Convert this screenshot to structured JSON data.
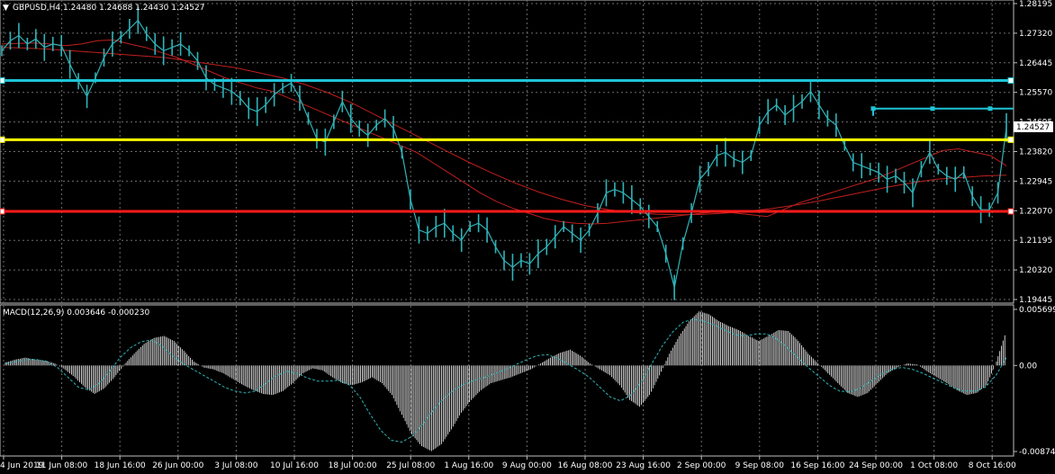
{
  "header": {
    "symbol_info": "GBPUSD,H4  1.24480 1.24688 1.24430 1.24527"
  },
  "macd": {
    "label": "MACD(12,26,9) 0.003646 -0.000230"
  },
  "price_axis": {
    "ticks": [
      "1.28195",
      "1.27320",
      "1.26445",
      "1.25570",
      "1.24695",
      "1.23820",
      "1.22945",
      "1.22070",
      "1.21195",
      "1.20320",
      "1.19445"
    ]
  },
  "macd_axis": {
    "ticks": [
      "0.005699",
      "0.00",
      "-0.008748"
    ]
  },
  "time_axis": {
    "labels": [
      "4 Jun 2019",
      "11 Jun 08:00",
      "18 Jun 16:00",
      "26 Jun 00:00",
      "3 Jul 08:00",
      "10 Jul 16:00",
      "18 Jul 00:00",
      "25 Jul 08:00",
      "1 Aug 16:00",
      "9 Aug 00:00",
      "16 Aug 08:00",
      "23 Aug 16:00",
      "2 Sep 00:00",
      "9 Sep 08:00",
      "16 Sep 16:00",
      "24 Sep 00:00",
      "1 Oct 08:00",
      "8 Oct 16:00"
    ]
  },
  "current_price": "1.24527",
  "colors": {
    "background": "#000000",
    "candle": "#2fb3b8",
    "ma": "#c0201c",
    "cyan_line": "#1ec4d6",
    "yellow_line": "#ffff00",
    "red_line": "#ff1a1a",
    "macd_hist": "#ffffff",
    "macd_signal": "#2fb3b8",
    "grid": "#6d6d6d"
  },
  "chart_data": [
    {
      "type": "line",
      "title": "GBPUSD,H4",
      "series": [
        {
          "values": [
            1.268,
            1.271,
            1.2725,
            1.27,
            1.2715,
            1.269,
            1.27,
            1.2695,
            1.264,
            1.259,
            1.2545,
            1.26,
            1.266,
            1.27,
            1.272,
            1.2745,
            1.277,
            1.273,
            1.27,
            1.268,
            1.269,
            1.27,
            1.268,
            1.265,
            1.26,
            1.258,
            1.257,
            1.256,
            1.254,
            1.251,
            1.25,
            1.252,
            1.255,
            1.257,
            1.2585,
            1.254,
            1.248,
            1.242,
            1.241,
            1.247,
            1.253,
            1.248,
            1.245,
            1.243,
            1.246,
            1.248,
            1.245,
            1.238,
            1.224,
            1.215,
            1.214,
            1.216,
            1.217,
            1.214,
            1.212,
            1.216,
            1.217,
            1.215,
            1.21,
            1.206,
            1.204,
            1.206,
            1.205,
            1.208,
            1.21,
            1.213,
            1.216,
            1.214,
            1.212,
            1.215,
            1.22,
            1.226,
            1.227,
            1.226,
            1.224,
            1.222,
            1.219,
            1.216,
            1.208,
            1.198,
            1.211,
            1.22,
            1.23,
            1.233,
            1.237,
            1.238,
            1.236,
            1.235,
            1.237,
            1.246,
            1.25,
            1.252,
            1.249,
            1.251,
            1.253,
            1.256,
            1.252,
            1.248,
            1.246,
            1.24,
            1.235,
            1.234,
            1.233,
            1.232,
            1.23,
            1.231,
            1.229,
            1.226,
            1.233,
            1.238,
            1.233,
            1.231,
            1.23,
            1.232,
            1.225,
            1.221,
            1.221,
            1.226,
            1.2453
          ]
        },
        {
          "values": [
            1.27,
            1.2702,
            1.2703,
            1.27,
            1.2695,
            1.27,
            1.271,
            1.2712,
            1.27,
            1.269,
            1.2675,
            1.266,
            1.264,
            1.262,
            1.26,
            1.2585,
            1.257,
            1.256,
            1.254,
            1.252,
            1.25,
            1.248,
            1.246,
            1.244,
            1.242,
            1.24,
            1.238,
            1.235,
            1.232,
            1.229,
            1.226,
            1.2235,
            1.2215,
            1.22,
            1.2185,
            1.2175,
            1.217,
            1.2168,
            1.217,
            1.2175,
            1.218,
            1.2185,
            1.219,
            1.2195,
            1.22,
            1.2205,
            1.22,
            1.2195,
            1.219,
            1.221,
            1.223,
            1.2245,
            1.226,
            1.2275,
            1.229,
            1.2305,
            1.2325,
            1.2345,
            1.2365,
            1.2385,
            1.239,
            1.238,
            1.237,
            1.234
          ]
        },
        {
          "values": [
            1.269,
            1.2688,
            1.2685,
            1.268,
            1.2675,
            1.267,
            1.2665,
            1.266,
            1.265,
            1.264,
            1.263,
            1.2615,
            1.26,
            1.258,
            1.2555,
            1.2525,
            1.249,
            1.2455,
            1.242,
            1.2385,
            1.235,
            1.2318,
            1.2288,
            1.2262,
            1.224,
            1.2222,
            1.221,
            1.2202,
            1.2197,
            1.2195,
            1.2196,
            1.22,
            1.2206,
            1.2214,
            1.2224,
            1.2236,
            1.225,
            1.2264,
            1.2278,
            1.229,
            1.23,
            1.2305,
            1.231,
            1.2312
          ]
        }
      ],
      "hlines": [
        1.2592,
        1.2417,
        1.2205
      ],
      "segment": [
        1.2509
      ],
      "ylim": [
        1.19445,
        1.28195
      ]
    },
    {
      "type": "bar",
      "title": "MACD(12,26,9)",
      "series": [
        {
          "values": [
            0.0003,
            0.0006,
            0.0008,
            0.0006,
            0.0005,
            0.0002,
            -0.0004,
            -0.0012,
            -0.0022,
            -0.0029,
            -0.0023,
            -0.0012,
            0.0001,
            0.0012,
            0.0022,
            0.0028,
            0.003,
            0.0025,
            0.0015,
            0.0004,
            -0.0002,
            -0.0004,
            -0.0008,
            -0.0014,
            -0.002,
            -0.0025,
            -0.0029,
            -0.003,
            -0.0026,
            -0.0018,
            -0.0008,
            -0.0003,
            -0.0005,
            -0.0012,
            -0.0018,
            -0.002,
            -0.0017,
            -0.0012,
            -0.0018,
            -0.003,
            -0.005,
            -0.007,
            -0.0082,
            -0.0087,
            -0.008,
            -0.0065,
            -0.0048,
            -0.0035,
            -0.0025,
            -0.0018,
            -0.0015,
            -0.0012,
            -0.0008,
            -0.0004,
            0.0002,
            0.0008,
            0.0013,
            0.0016,
            0.001,
            0.0002,
            -0.0004,
            -0.001,
            -0.002,
            -0.0035,
            -0.0042,
            -0.003,
            -0.001,
            0.0012,
            0.003,
            0.0045,
            0.0055,
            0.0052,
            0.0045,
            0.004,
            0.0036,
            0.003,
            0.0025,
            0.003,
            0.0036,
            0.0035,
            0.0025,
            0.0012,
            0.0002,
            -0.0008,
            -0.0018,
            -0.0028,
            -0.0032,
            -0.0028,
            -0.0018,
            -0.0008,
            -0.0002,
            0.0002,
            0.0001,
            -0.0006,
            -0.0012,
            -0.0018,
            -0.0025,
            -0.003,
            -0.0028,
            -0.002,
            0.0004,
            0.0036
          ]
        },
        {
          "values": [
            0.0002,
            0.0004,
            0.0006,
            0.0006,
            0.0004,
            -0.0002,
            -0.0012,
            -0.0022,
            -0.0025,
            -0.0018,
            -0.0006,
            0.0008,
            0.0018,
            0.0024,
            0.0026,
            0.002,
            0.001,
            0.0002,
            -0.0004,
            -0.001,
            -0.0016,
            -0.0022,
            -0.0026,
            -0.0028,
            -0.0026,
            -0.0018,
            -0.001,
            -0.0006,
            -0.0008,
            -0.0013,
            -0.0016,
            -0.0016,
            -0.0015,
            -0.002,
            -0.0032,
            -0.005,
            -0.0066,
            -0.0076,
            -0.0078,
            -0.0072,
            -0.006,
            -0.0046,
            -0.0034,
            -0.0025,
            -0.0019,
            -0.0015,
            -0.0012,
            -0.0008,
            -0.0004,
            0.0001,
            0.0006,
            0.001,
            0.0011,
            0.0007,
            0.0001,
            -0.0005,
            -0.0012,
            -0.0022,
            -0.0032,
            -0.0036,
            -0.003,
            -0.0016,
            0.0002,
            0.002,
            0.0034,
            0.0044,
            0.0047,
            0.0045,
            0.0041,
            0.0036,
            0.0031,
            0.003,
            0.0032,
            0.0032,
            0.0027,
            0.0018,
            0.0008,
            -0.0002,
            -0.0011,
            -0.002,
            -0.0026,
            -0.0027,
            -0.0023,
            -0.0016,
            -0.0009,
            -0.0004,
            -0.0002,
            -0.0004,
            -0.0008,
            -0.0013,
            -0.0018,
            -0.0023,
            -0.0026,
            -0.0026,
            -0.0022,
            -0.001,
            0.0008
          ]
        }
      ],
      "ylim": [
        -0.008748,
        0.005699
      ]
    }
  ]
}
